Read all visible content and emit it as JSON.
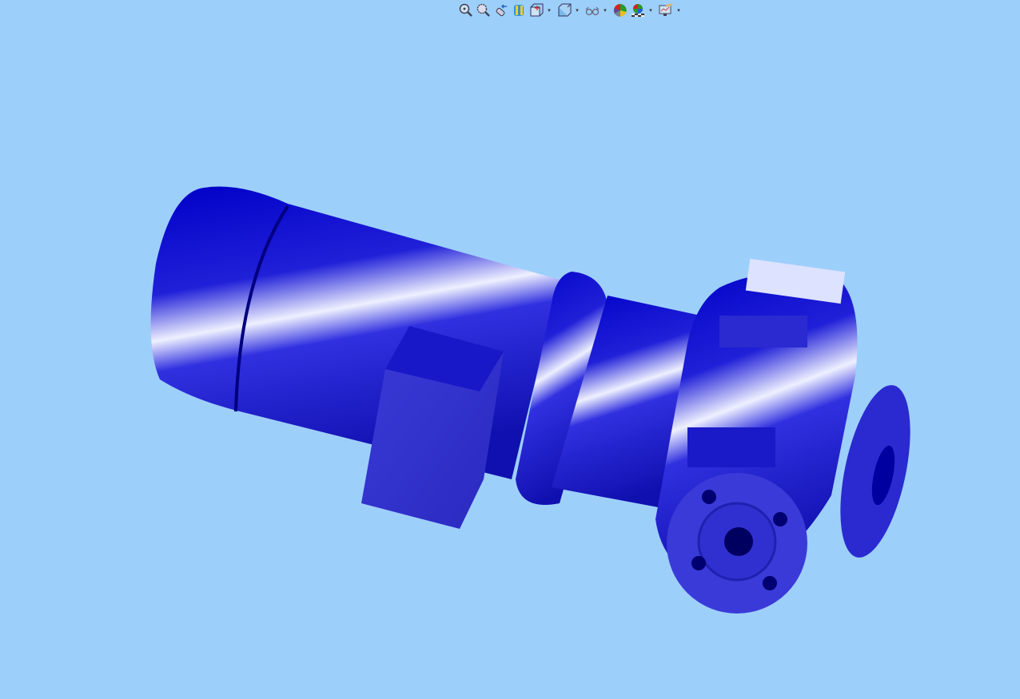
{
  "toolbar": {
    "items": [
      {
        "icon": "zoom-to-fit-icon",
        "dropdown": false
      },
      {
        "icon": "zoom-to-area-icon",
        "dropdown": false
      },
      {
        "icon": "previous-view-icon",
        "dropdown": false
      },
      {
        "icon": "section-view-icon",
        "dropdown": false
      },
      {
        "icon": "view-orientation-icon",
        "dropdown": true
      },
      {
        "icon": "display-style-icon",
        "dropdown": true
      },
      {
        "icon": "hide-show-items-icon",
        "dropdown": true
      },
      {
        "icon": "edit-appearance-icon",
        "dropdown": false
      },
      {
        "icon": "apply-scene-icon",
        "dropdown": true
      },
      {
        "icon": "view-settings-icon",
        "dropdown": true
      }
    ],
    "dropdown_glyph": "▾"
  },
  "colors": {
    "background": "#9dcffb",
    "model": "#1a1ad6",
    "model_highlight": "#e8ecff"
  }
}
